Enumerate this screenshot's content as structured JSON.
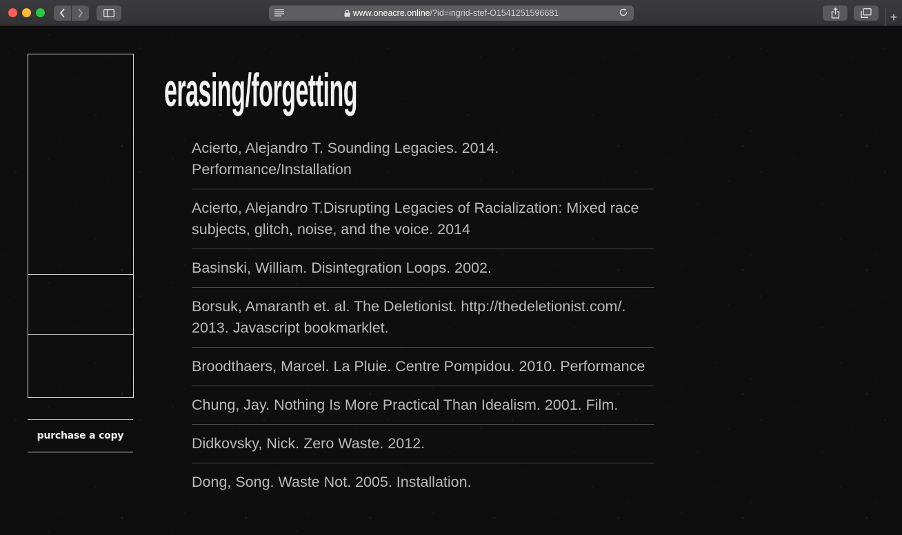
{
  "browser": {
    "url_domain": "www.oneacre.online",
    "url_rest": "/?id=ingrid-stef-O1541251596681",
    "icons": [
      "back-icon",
      "forward-icon",
      "sidebar-icon",
      "reader-icon",
      "lock-icon",
      "reload-icon",
      "share-icon",
      "tabs-icon",
      "plus-icon"
    ]
  },
  "page": {
    "title": "erasing/forgetting",
    "purchase_label": "purchase a copy",
    "entries": [
      "Acierto, Alejandro T. Sounding Legacies. 2014. Performance/Installation",
      "Acierto, Alejandro T.Disrupting Legacies of Racialization: Mixed race subjects, glitch, noise, and the voice. 2014",
      "Basinski, William. Disintegration Loops. 2002.",
      "Borsuk, Amaranth et. al. The Deletionist. http://thedeletionist.com/. 2013. Javascript bookmarklet.",
      "Broodthaers, Marcel. La Pluie. Centre Pompidou. 2010. Performance",
      "Chung, Jay. Nothing Is More Practical Than Idealism. 2001. Film.",
      "Didkovsky, Nick. Zero Waste. 2012.",
      "Dong, Song. Waste Not. 2005. Installation."
    ]
  },
  "colors": {
    "background": "#0e0e0e",
    "text": "#b9b9b9",
    "title": "#f2f2f2"
  }
}
